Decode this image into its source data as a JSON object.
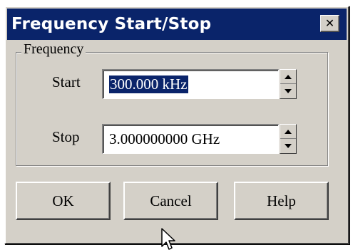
{
  "window": {
    "title": "Frequency Start/Stop",
    "close_icon": "close-icon"
  },
  "group": {
    "label": "Frequency"
  },
  "start": {
    "label": "Start",
    "value": "300.000 kHz"
  },
  "stop": {
    "label": "Stop",
    "value": "3.000000000 GHz"
  },
  "buttons": {
    "ok": "OK",
    "cancel": "Cancel",
    "help": "Help"
  },
  "colors": {
    "titlebar": "#0a246a",
    "face": "#d4d0c8",
    "selection": "#0a246a"
  }
}
